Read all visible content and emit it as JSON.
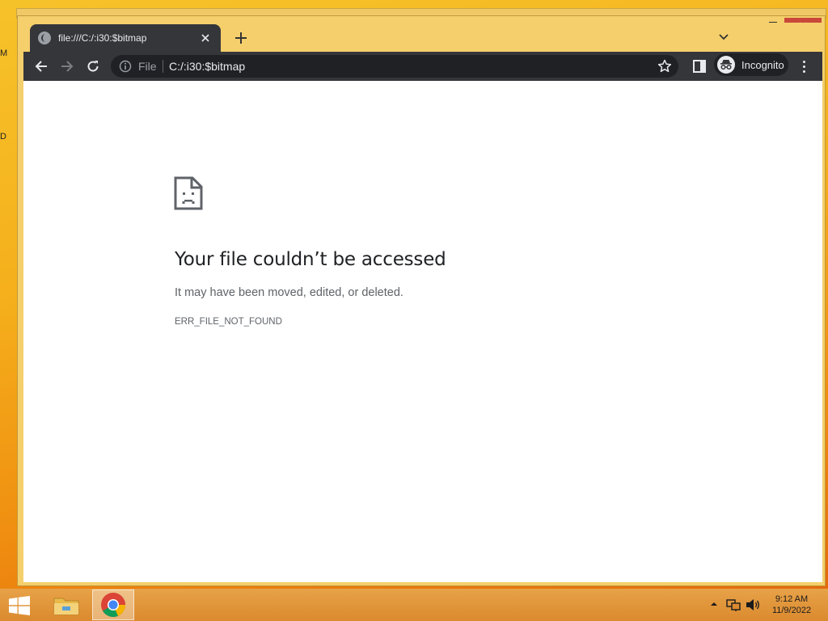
{
  "tab": {
    "title": "file:///C:/:i30:$bitmap"
  },
  "omnibox": {
    "chip": "File",
    "url": "C:/:i30:$bitmap"
  },
  "profile": {
    "label": "Incognito"
  },
  "error": {
    "title": "Your file couldn’t be accessed",
    "subtitle": "It may have been moved, edited, or deleted.",
    "code": "ERR_FILE_NOT_FOUND"
  },
  "clock": {
    "time": "9:12 AM",
    "date": "11/9/2022"
  },
  "desktop": {
    "letters": [
      "M",
      "D"
    ]
  },
  "colors": {
    "toolbar": "#35363a",
    "omnibox": "#202124",
    "taskbar": "#db8a2e",
    "close": "#c9483a"
  }
}
